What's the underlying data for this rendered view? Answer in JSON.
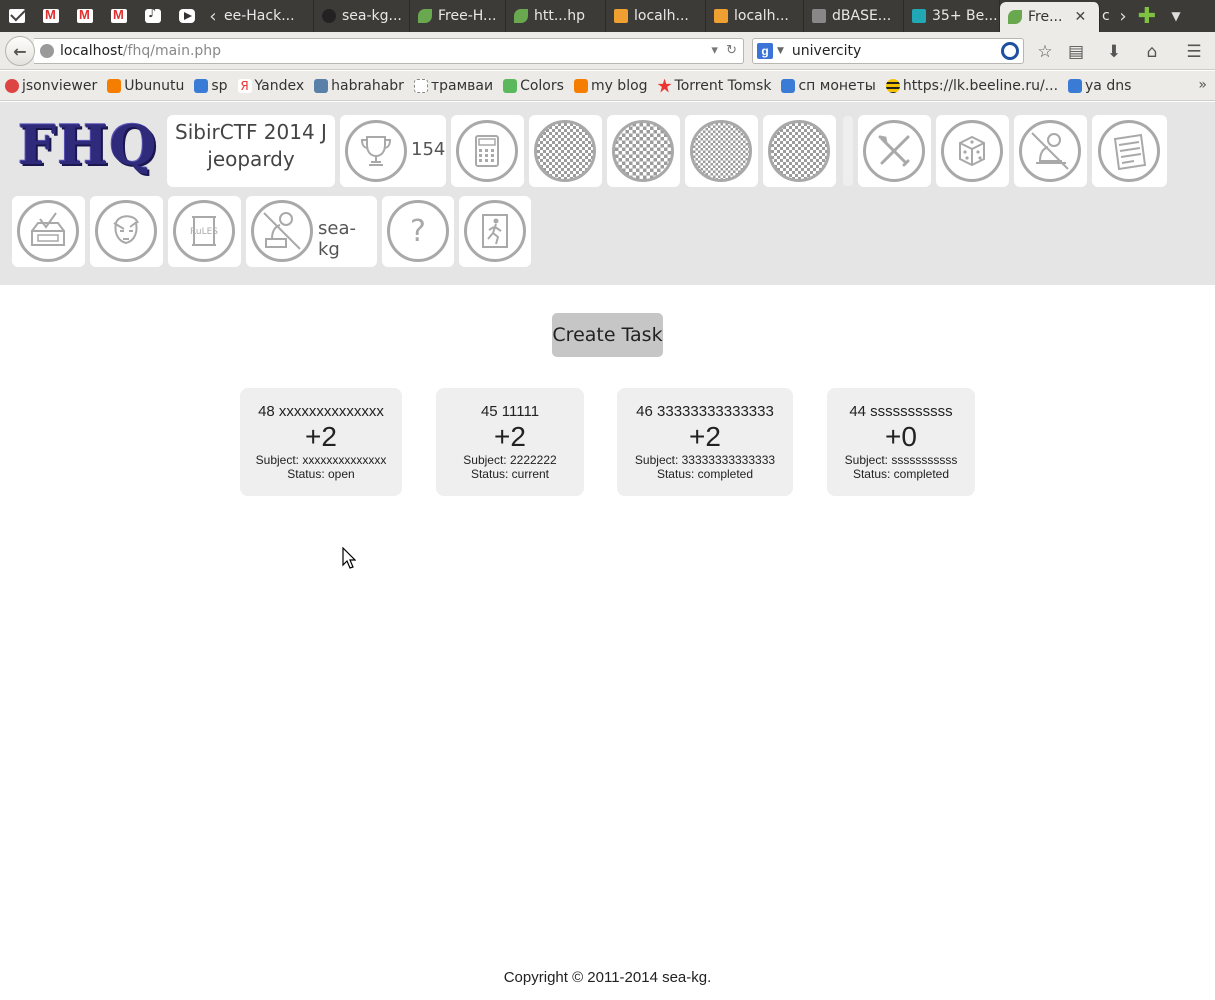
{
  "browser": {
    "pinned_tabs": [
      {
        "icon": "mail-icon"
      },
      {
        "icon": "gmail-icon"
      },
      {
        "icon": "gmail-icon"
      },
      {
        "icon": "gmail-icon"
      },
      {
        "icon": "music-icon"
      },
      {
        "icon": "play-icon"
      }
    ],
    "tabs": [
      {
        "label": "ee-Hack...",
        "icon_color": "#3c3b37"
      },
      {
        "label": "sea-kg...",
        "icon_color": "#222222"
      },
      {
        "label": "Free-H...",
        "icon_color": "#6aa84f"
      },
      {
        "label": "htt...hp",
        "icon_color": "#6aa84f"
      },
      {
        "label": "localh...",
        "icon_color": "#f0a030"
      },
      {
        "label": "localh...",
        "icon_color": "#f0a030"
      },
      {
        "label": "dBASE...",
        "icon_color": "#888888"
      },
      {
        "label": "35+ Be...",
        "icon_color": "#22a8b4"
      },
      {
        "label": "Fre...",
        "icon_color": "#6aa84f",
        "active": true
      },
      {
        "label": "c",
        "icon_color": "#3c3b37"
      }
    ],
    "url_host": "localhost",
    "url_path": "/fhq/main.php",
    "search_value": "univercity",
    "search_engine_letter": "g",
    "bookmarks": [
      {
        "label": "jsonviewer",
        "color": "#d44"
      },
      {
        "label": "Ubunutu",
        "color": "#f57d00"
      },
      {
        "label": "sp",
        "color": "#3a7bd5"
      },
      {
        "label": "Yandex",
        "color": "#e33"
      },
      {
        "label": "habrahabr",
        "color": "#5a7fa8"
      },
      {
        "label": "трамваи",
        "color": "#ffffff"
      },
      {
        "label": "Colors",
        "color": "#5cb85c"
      },
      {
        "label": "my blog",
        "color": "#f57d00"
      },
      {
        "label": "Torrent Tomsk",
        "color": "#e33"
      },
      {
        "label": "сп монеты",
        "color": "#3a7bd5"
      },
      {
        "label": "https://lk.beeline.ru/...",
        "color": "#f5c400"
      },
      {
        "label": "ya dns",
        "color": "#3a7bd5"
      }
    ]
  },
  "header": {
    "logo": "FHQ",
    "game_title_line1": "SibirCTF 2014 J",
    "game_title_line2": "jeopardy",
    "score": "154",
    "username": "sea-kg",
    "icons": [
      "trophy-icon",
      "calculator-icon",
      "qr-icon",
      "qr-icon",
      "qr-icon",
      "qr-icon",
      "tools-icon",
      "dice-icon",
      "user-at-desk-icon",
      "news-icon",
      "feedback-box-icon",
      "avatar-icon",
      "rules-scroll-icon",
      "user-at-computer-icon",
      "help-icon",
      "exit-icon"
    ]
  },
  "main": {
    "create_task_label": "Create Task",
    "tasks": [
      {
        "title": "48 xxxxxxxxxxxxxx",
        "score": "+2",
        "subject": "Subject: xxxxxxxxxxxxxx",
        "status": "Status: open"
      },
      {
        "title": "45 11111",
        "score": "+2",
        "subject": "Subject: 2222222",
        "status": "Status: current"
      },
      {
        "title": "46 33333333333333",
        "score": "+2",
        "subject": "Subject: 33333333333333",
        "status": "Status: completed"
      },
      {
        "title": "44 sssssssssss",
        "score": "+0",
        "subject": "Subject: sssssssssss",
        "status": "Status: completed"
      }
    ]
  },
  "footer": {
    "copyright": "Copyright © 2011-2014 sea-kg."
  },
  "colors": {
    "header_bg": "#e5e5e5",
    "logo": "#2f2a7a",
    "card_bg": "#efefef",
    "button_bg": "#c6c6c6",
    "icon_stroke": "#a9a9a9"
  }
}
